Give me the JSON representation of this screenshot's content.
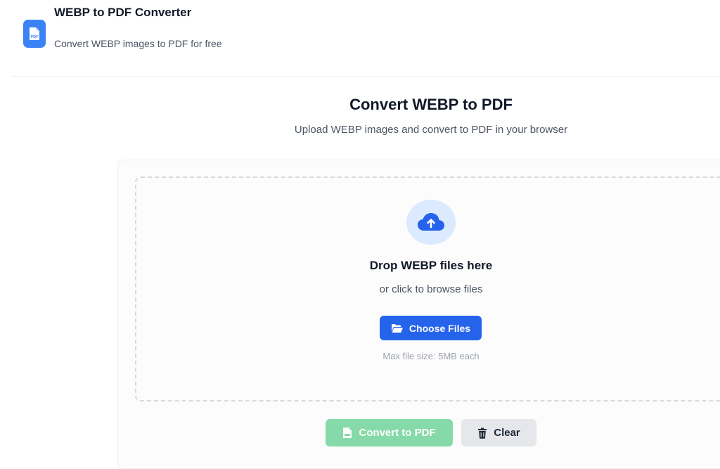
{
  "header": {
    "title": "WEBP to PDF Converter",
    "subtitle": "Convert WEBP images to PDF for free",
    "logo_text": "PDF",
    "logo_icon": "pdf-file-icon"
  },
  "main": {
    "title": "Convert WEBP to PDF",
    "subtitle": "Upload WEBP images and convert to PDF in your browser"
  },
  "dropzone": {
    "icon": "cloud-upload-icon",
    "title": "Drop WEBP files here",
    "subtitle": "or click to browse files",
    "choose_label": "Choose Files",
    "choose_icon": "folder-open-icon",
    "max_size": "Max file size: 5MB each"
  },
  "actions": {
    "convert_label": "Convert to PDF",
    "convert_icon": "pdf-file-icon",
    "convert_enabled": false,
    "clear_label": "Clear",
    "clear_icon": "trash-icon"
  },
  "colors": {
    "primary": "#2563eb",
    "logo": "#3b82f6",
    "convert_disabled": "#86d9a8",
    "clear_bg": "#e5e7eb",
    "upload_circle": "#dbeafe"
  }
}
